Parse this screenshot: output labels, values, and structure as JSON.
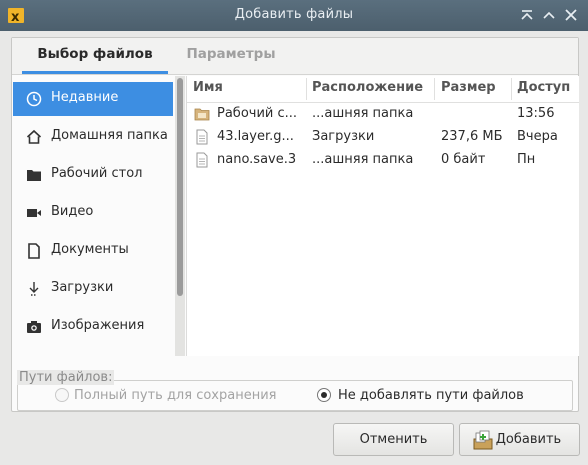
{
  "window": {
    "title": "Добавить файлы",
    "icons": [
      "app-icon",
      "minimize-icon",
      "maximize-icon",
      "close-icon"
    ]
  },
  "tabs": {
    "files": "Выбор файлов",
    "params": "Параметры"
  },
  "sidebar": {
    "items": [
      {
        "label": "Недавние",
        "icon": "recent-clock-icon",
        "active": true
      },
      {
        "label": "Домашняя папка",
        "icon": "home-icon"
      },
      {
        "label": "Рабочий стол",
        "icon": "folder-icon"
      },
      {
        "label": "Видео",
        "icon": "video-icon"
      },
      {
        "label": "Документы",
        "icon": "document-icon"
      },
      {
        "label": "Загрузки",
        "icon": "download-icon"
      },
      {
        "label": "Изображения",
        "icon": "camera-icon"
      }
    ]
  },
  "list": {
    "headers": [
      "Имя",
      "Расположение",
      "Размер",
      "Доступ"
    ],
    "rows": [
      {
        "name": "Рабочий с...",
        "location": "...ашняя папка",
        "size": "",
        "access": "13:56",
        "icon": "folder-icon"
      },
      {
        "name": "43.layer.g...",
        "location": "Загрузки",
        "size": "237,6 МБ",
        "access": "Вчера",
        "icon": "file-icon"
      },
      {
        "name": "nano.save.3",
        "location": "...ашняя папка",
        "size": "0 байт",
        "access": "Пн",
        "icon": "file-icon"
      }
    ]
  },
  "paths": {
    "label": "Пути файлов:",
    "option_full": "Полный путь для сохранения",
    "option_none": "Не добавлять пути файлов",
    "selected": "option_none"
  },
  "buttons": {
    "cancel": "Отменить",
    "add": "Добавить"
  },
  "colors": {
    "accent": "#3d8ee2",
    "titlebar": "#52687a"
  }
}
